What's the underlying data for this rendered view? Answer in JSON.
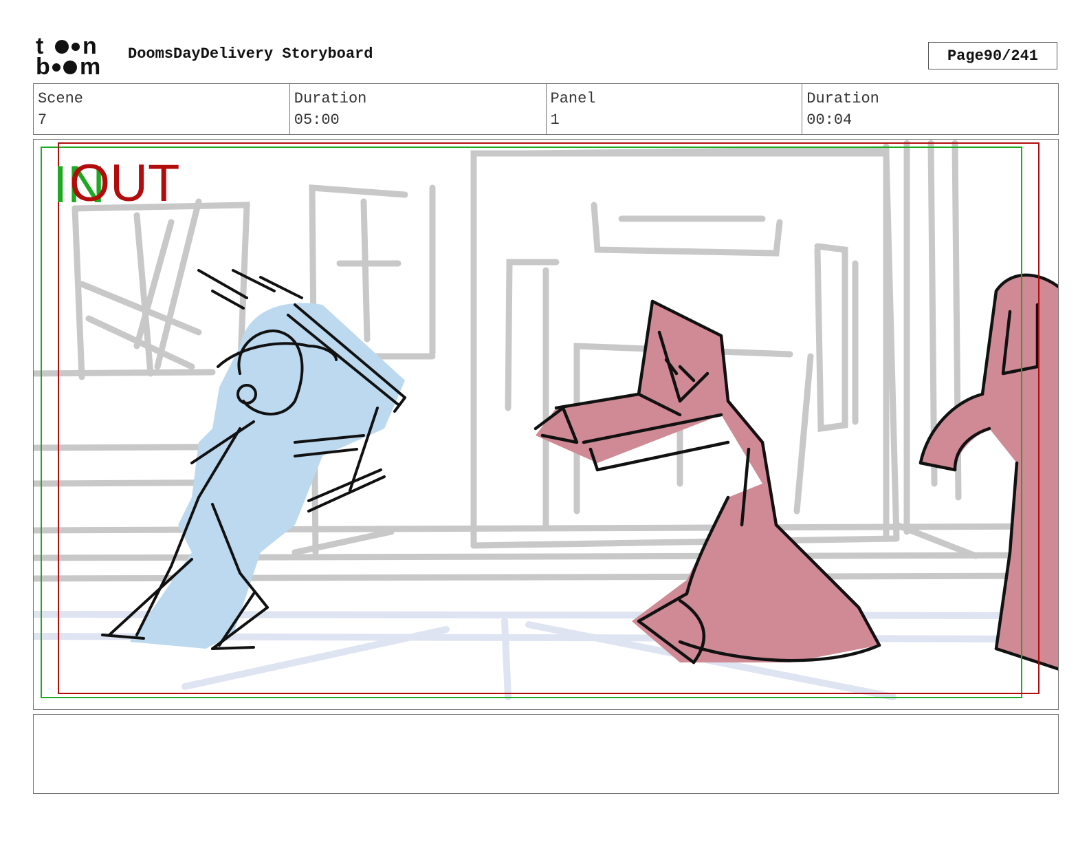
{
  "header": {
    "logo_text_top": "toon",
    "logo_text_bottom": "boom",
    "title": "DoomsDayDelivery Storyboard",
    "page_label": "Page",
    "page_value": "90/241"
  },
  "info": {
    "scene_label": "Scene",
    "scene_value": "7",
    "duration_label": "Duration",
    "duration_value": "05:00",
    "panel_label": "Panel",
    "panel_value": "1",
    "panel_duration_label": "Duration",
    "panel_duration_value": "00:04"
  },
  "frame": {
    "in_label": "IN",
    "out_label": "OUT",
    "in_color": "#1daa22",
    "out_color": "#b20c0c"
  },
  "colors": {
    "background_sketch": "#c8c8c8",
    "character_blue": "#bcd9f0",
    "character_pink": "#d08a96",
    "line": "#111111"
  },
  "notes": {
    "text": ""
  }
}
